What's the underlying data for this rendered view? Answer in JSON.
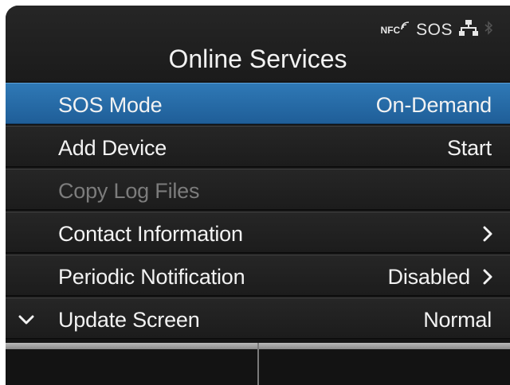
{
  "header": {
    "title": "Online Services",
    "status": {
      "nfc_label": "NFC",
      "sos_label": "SOS",
      "icons": [
        "nfc-icon",
        "network-icon",
        "bluetooth-icon"
      ]
    }
  },
  "menu": {
    "items": [
      {
        "label": "SOS Mode",
        "value": "On-Demand",
        "selected": true,
        "enabled": true
      },
      {
        "label": "Add Device",
        "value": "Start",
        "enabled": true
      },
      {
        "label": "Copy Log Files",
        "value": "",
        "enabled": false
      },
      {
        "label": "Contact Information",
        "value": "",
        "enabled": true,
        "chevron": "chevron-right-icon"
      },
      {
        "label": "Periodic Notification",
        "value": "Disabled",
        "enabled": true,
        "chevron": "chevron-right-icon"
      },
      {
        "label": "Update Screen",
        "value": "Normal",
        "enabled": true,
        "scroll_indicator": "chevron-down-icon"
      }
    ]
  },
  "softkeys": [
    {
      "label": ""
    },
    {
      "label": ""
    }
  ],
  "colors": {
    "selected_row": "#2a6fab",
    "background": "#141414",
    "text": "#f2f2f2",
    "disabled_text": "#7c7c7c"
  }
}
